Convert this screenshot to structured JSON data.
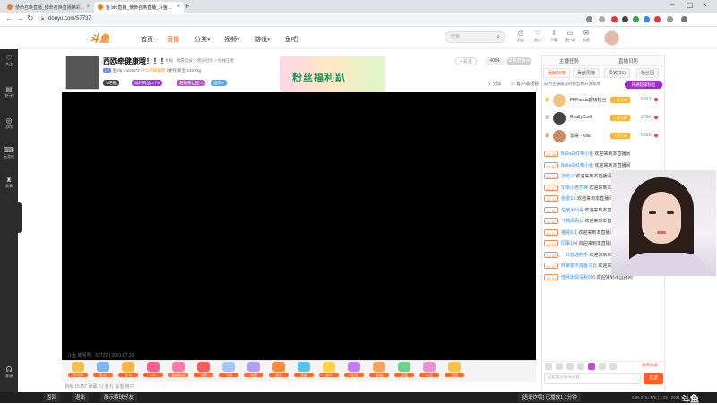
{
  "browser": {
    "tabs": [
      "使命召唤直播_使命召唤直播精彩...",
      "鱼 bfq直播_使命召唤直播_斗鱼...",
      ""
    ],
    "url": "douyu.com/57737"
  },
  "site": {
    "logo": "斗鱼",
    "nav": [
      "首页",
      "直播",
      "分类▾",
      "视频▾",
      "游戏▾",
      "鱼吧"
    ],
    "search_placeholder": "搜索",
    "header_actions": [
      "历史",
      "关注",
      "下载",
      "客户端",
      "消息"
    ]
  },
  "sidebar": {
    "items": [
      "关注",
      "排行榜",
      "游戏",
      "云游戏",
      "赛事",
      "客服"
    ]
  },
  "room": {
    "title": "西欧牵健康哦！！！",
    "report": "举报",
    "categories": "网游竞技 > 使命召唤 > 枪械王者",
    "anchor_level": "LV",
    "anchor_name": "鱼bfq",
    "hot": "164072",
    "ffo": "FFO不知道所",
    "fans": "7委托",
    "tag1": "新宝",
    "tag2": "215.7kg",
    "badges": [
      "V吧推",
      "福利商品 3 / 5",
      "超级粉丝团 >",
      "推荐0"
    ],
    "banner": "粉丝福利趴",
    "follow_label": "+关注",
    "follow_count": "4084",
    "report_btn": "举报直播间",
    "share": "分享",
    "client": "客户端观看",
    "video_info": "斗鱼 房间号：57737 | 2021.07.20"
  },
  "gifts": [
    {
      "label": "荧光棒",
      "color": "#f3c04a"
    },
    {
      "label": "鱼丸",
      "color": "#7ab8f5"
    },
    {
      "label": "办卡",
      "color": "#ffb347"
    },
    {
      "label": "PK",
      "color": "#ff5d8f"
    },
    {
      "label": "超级粉丝",
      "color": "#ff7aa8"
    },
    {
      "label": "火箭",
      "color": "#ff5a5a"
    },
    {
      "label": "飞机",
      "color": "#a0c7ff"
    },
    {
      "label": "城堡",
      "color": "#b59cf5"
    },
    {
      "label": "超火",
      "color": "#ff8a3d"
    },
    {
      "label": "游艇",
      "color": "#58c2f0"
    },
    {
      "label": "跑车",
      "color": "#ffd24a"
    },
    {
      "label": "礼包",
      "color": "#c47ef5"
    },
    {
      "label": "宝箱",
      "color": "#f5a25a"
    },
    {
      "label": "星星",
      "color": "#6cd38c"
    },
    {
      "label": "公主",
      "color": "#e890d8"
    },
    {
      "label": "王冠",
      "color": "#f6c24a"
    }
  ],
  "bottom_strip": "剩余  15157  弹幕  0  |  鱼丸  充值  用户",
  "right_panel": {
    "tabs1": [
      "主播任务",
      "直播日历"
    ],
    "tabs2": [
      "贡献日榜",
      "贡献周榜",
      "贵宾(21)",
      "粉丝团"
    ],
    "prompt": "成为主播最爱的粉丝和开发帮哦",
    "open_btn": "开通超级粉丝",
    "ranks": [
      {
        "crown": "♛",
        "name": "FFPanda超级粉丝",
        "level": "土豪大佬",
        "score": "6294",
        "avatar": "#f1c37c",
        "crown_color": "#ffb400"
      },
      {
        "crown": "♛",
        "name": "ReallyCool",
        "level": "土豪大佬",
        "score": "5784",
        "avatar": "#444",
        "crown_color": "#b3b3b3"
      },
      {
        "crown": "♛",
        "name": "雷哥 - Vila",
        "level": "土豪大佬",
        "score": "5580",
        "avatar": "#c98b64",
        "crown_color": "#d08a4c"
      }
    ],
    "chat": [
      {
        "level": "LV 38",
        "user": "Bella白红带小鱼",
        "text": "欢迎来到本直播间"
      },
      {
        "level": "LV 33",
        "user": "Bella白红带小鱼",
        "text": "欢迎来到本直播间"
      },
      {
        "level": "LV 12",
        "user": "还可以",
        "text": "欢迎来到本直播间"
      },
      {
        "level": "LV 17",
        "user": "SSB小老司神",
        "text": "欢迎来到本直播间"
      },
      {
        "level": "LV 33",
        "user": "张雷SX",
        "text": "欢迎来到本直播间"
      },
      {
        "level": "LV 19",
        "user": "左散大仙哥",
        "text": "欢迎来到本直播间"
      },
      {
        "level": "LV 21",
        "user": "飞鸽阁阁长",
        "text": "欢迎来到本直播间"
      },
      {
        "level": "LV 17",
        "user": "猫哥911",
        "text": "欢迎来到本直播间"
      },
      {
        "level": "LV 16",
        "user": "同事104",
        "text": "欢迎来到本直播间"
      },
      {
        "level": "LV 15",
        "user": "一只普通的牛",
        "text": "欢迎来到本直播间"
      },
      {
        "level": "LV 13",
        "user": "终聚要不成鱼马云",
        "text": "欢迎来到本直播间"
      },
      {
        "level": "LV 14",
        "user": "倍月出现深秋900",
        "text": "欢迎来到本直播间"
      }
    ],
    "cash_btn": "更新多帧",
    "input_placeholder": "这是输入聊天内容",
    "send": "发送"
  },
  "taskbar": {
    "items": [
      "返回",
      "退出",
      "展示赛球好友",
      "[语录炸鸭] 已播放1.1分钟"
    ],
    "clock": "6.96.9x6=776 | 3.03 - 2021 6.11 9",
    "brand": "斗鱼"
  }
}
